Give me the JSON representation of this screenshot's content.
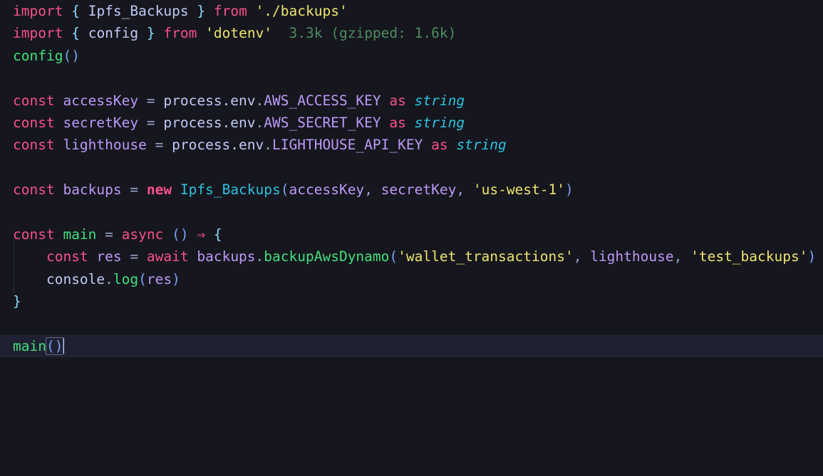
{
  "editor": {
    "theme_name": "tokyo-night",
    "background": "#16161e",
    "active_line_background": "#1f2132",
    "language": "typescript",
    "cursor_line": 14,
    "cursor_column": 7
  },
  "colors": {
    "keyword": "#f7518b",
    "brace": "#89ddff",
    "paren": "#7aa2f7",
    "identifier": "#c0caf5",
    "variable": "#bb9af7",
    "class": "#2ac3de",
    "type": "#2ac3de",
    "function": "#41e07c",
    "string": "#ede56e",
    "import_cost": "#4e8c5f",
    "caret": "#c0caf5",
    "indent_guide": "#2a2c3d"
  },
  "annotations": {
    "import_cost_dotenv": "3.3k (gzipped: 1.6k)"
  },
  "code": {
    "line1": {
      "kw_import": "import",
      "brace_open": "{",
      "name": "Ipfs_Backups",
      "brace_close": "}",
      "kw_from": "from",
      "module": "'./backups'"
    },
    "line2": {
      "kw_import": "import",
      "brace_open": "{",
      "name": "config",
      "brace_close": "}",
      "kw_from": "from",
      "module": "'dotenv'",
      "cost": "3.3k (gzipped: 1.6k)"
    },
    "line3": {
      "fn": "config",
      "parens": "()"
    },
    "line5": {
      "kw_const": "const",
      "varname": "accessKey",
      "eq": "=",
      "object": "process.env",
      "dot": ".",
      "prop": "AWS_ACCESS_KEY",
      "kw_as": "as",
      "type": "string"
    },
    "line6": {
      "kw_const": "const",
      "varname": "secretKey",
      "eq": "=",
      "object": "process.env",
      "dot": ".",
      "prop": "AWS_SECRET_KEY",
      "kw_as": "as",
      "type": "string"
    },
    "line7": {
      "kw_const": "const",
      "varname": "lighthouse",
      "eq": "=",
      "object": "process.env",
      "dot": ".",
      "prop": "LIGHTHOUSE_API_KEY",
      "kw_as": "as",
      "type": "string"
    },
    "line9": {
      "kw_const": "const",
      "varname": "backups",
      "eq": "=",
      "kw_new": "new",
      "cls": "Ipfs_Backups",
      "paren_open": "(",
      "arg1": "accessKey",
      "comma1": ",",
      "arg2": "secretKey",
      "comma2": ",",
      "arg3": "'us-west-1'",
      "paren_close": ")"
    },
    "line11": {
      "kw_const": "const",
      "fn": "main",
      "eq": "=",
      "kw_async": "async",
      "parens": "()",
      "arrow": "⇒",
      "brace_open": "{"
    },
    "line12": {
      "indent": "    ",
      "kw_const": "const",
      "varname": "res",
      "eq": "=",
      "kw_await": "await",
      "object": "backups",
      "dot": ".",
      "method": "backupAwsDynamo",
      "paren_open": "(",
      "arg1": "'wallet_transactions'",
      "comma1": ",",
      "arg2": "lighthouse",
      "comma2": ",",
      "arg3": "'test_backups'",
      "paren_close": ")"
    },
    "line13": {
      "indent": "    ",
      "object": "console",
      "dot": ".",
      "method": "log",
      "paren_open": "(",
      "arg1": "res",
      "paren_close": ")"
    },
    "line14": {
      "brace_close": "}"
    },
    "line16": {
      "fn": "main",
      "parens": "()"
    }
  }
}
